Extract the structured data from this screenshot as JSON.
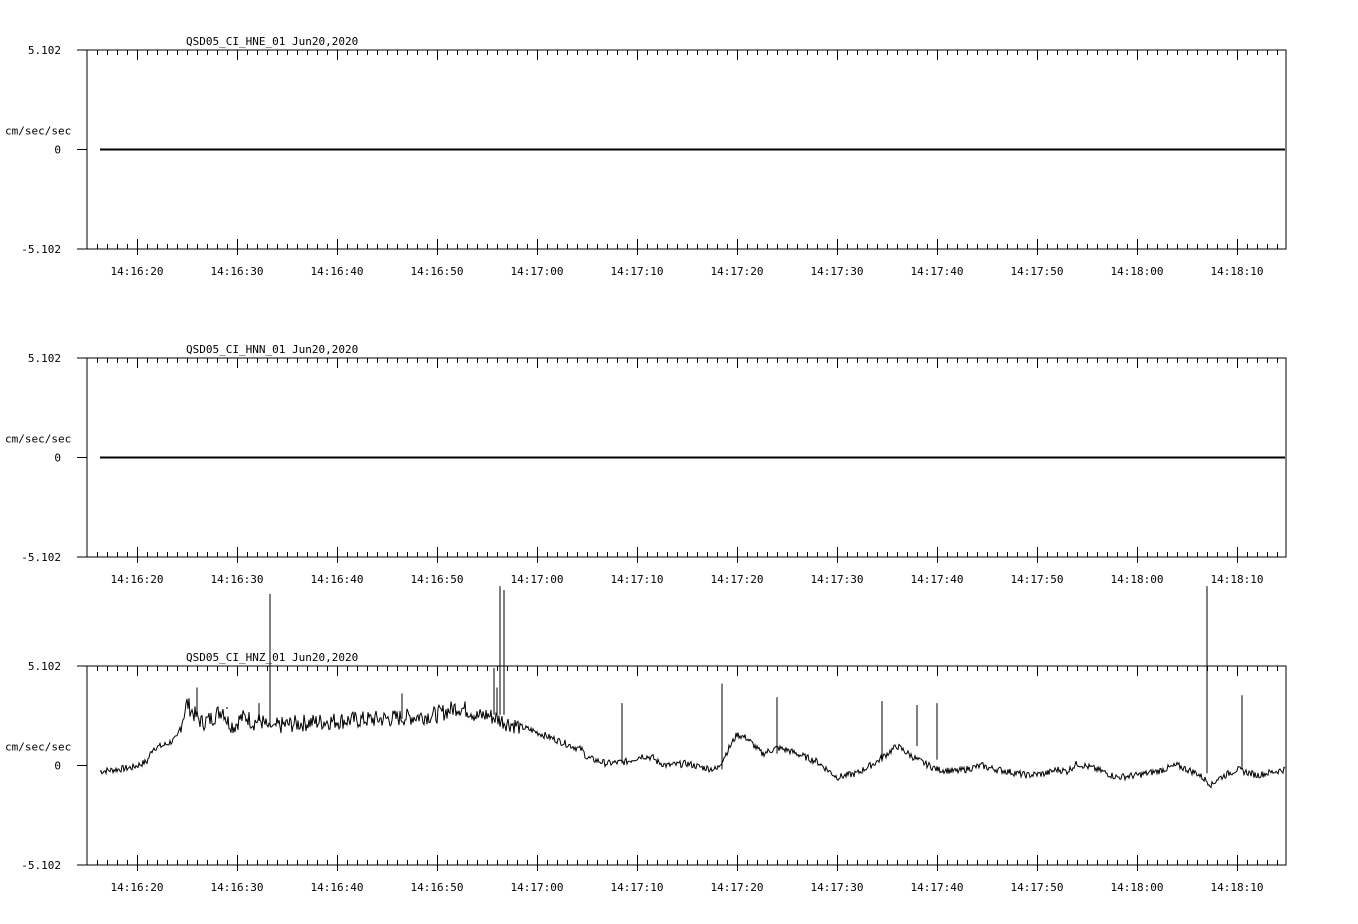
{
  "chart_data": [
    {
      "type": "line",
      "title": "QSD05_CI_HNE_01  Jun20,2020",
      "ylabel": "cm/sec/sec",
      "yticks": [
        "5.102",
        "0",
        "-5.102"
      ],
      "ylim": [
        -5.102,
        5.102
      ],
      "xticks": [
        "14:16:20",
        "14:16:30",
        "14:16:40",
        "14:16:50",
        "14:17:00",
        "14:17:10",
        "14:17:20",
        "14:17:30",
        "14:17:40",
        "14:17:50",
        "14:18:00",
        "14:18:10"
      ],
      "x_start_seconds_after_14_16_20": -3.7,
      "x_end_seconds_after_14_16_20": 114.8,
      "trace_style": "flat",
      "series": [
        {
          "x": [
            -3.7,
            114.8
          ],
          "y": [
            0,
            0
          ]
        }
      ]
    },
    {
      "type": "line",
      "title": "QSD05_CI_HNN_01  Jun20,2020",
      "ylabel": "cm/sec/sec",
      "yticks": [
        "5.102",
        "0",
        "-5.102"
      ],
      "ylim": [
        -5.102,
        5.102
      ],
      "xticks": [
        "14:16:20",
        "14:16:30",
        "14:16:40",
        "14:16:50",
        "14:17:00",
        "14:17:10",
        "14:17:20",
        "14:17:30",
        "14:17:40",
        "14:17:50",
        "14:18:00",
        "14:18:10"
      ],
      "x_start_seconds_after_14_16_20": -3.7,
      "x_end_seconds_after_14_16_20": 114.8,
      "trace_style": "flat",
      "series": [
        {
          "x": [
            -3.7,
            114.8
          ],
          "y": [
            0,
            0
          ]
        }
      ]
    },
    {
      "type": "line",
      "title": "QSD05_CI_HNZ_01  Jun20,2020",
      "ylabel": "cm/sec/sec",
      "yticks": [
        "5.102",
        "0",
        "-5.102"
      ],
      "ylim": [
        -5.102,
        5.102
      ],
      "xticks": [
        "14:16:20",
        "14:16:30",
        "14:16:40",
        "14:16:50",
        "14:17:00",
        "14:17:10",
        "14:17:20",
        "14:17:30",
        "14:17:40",
        "14:17:50",
        "14:18:00",
        "14:18:10"
      ],
      "x_start_seconds_after_14_16_20": -3.7,
      "x_end_seconds_after_14_16_20": 114.8,
      "trace_style": "noisy",
      "series": [
        {
          "x": [
            -3.7,
            -2.0,
            -0.5,
            1.0,
            1.6,
            2.5,
            3.0,
            4.0,
            5.0,
            5.6,
            6.5,
            7.4,
            8.6,
            9.0,
            9.7,
            10.3,
            11.0,
            11.6,
            12.0,
            12.4,
            13.0,
            13.2,
            13.8,
            15.0,
            17.0,
            20.0,
            25.0,
            30.0,
            32.0,
            33.4,
            34.0,
            35.0,
            37.0,
            39.5,
            41.0,
            43.0,
            44.5,
            45.0,
            47.0,
            49.0,
            50.5,
            51.6,
            52.0,
            53.0,
            55.0,
            56.5,
            58.0,
            60.0,
            61.0,
            62.5,
            64.0,
            65.0,
            68.0,
            70.0,
            72.0,
            74.0,
            76.0,
            78.0,
            80.0,
            82.0,
            84.5,
            85.0,
            87.0,
            89.0,
            91.0,
            92.0,
            93.0,
            94.0,
            96.0,
            98.0,
            100.0,
            102.0,
            104.0,
            106.0,
            107.5,
            108.0,
            110.0,
            112.0,
            114.8
          ],
          "y": [
            -0.3,
            -0.2,
            -0.1,
            0.2,
            0.9,
            1.0,
            1.1,
            1.4,
            3.2,
            2.7,
            2.2,
            2.4,
            2.9,
            2.3,
            2.0,
            2.4,
            2.5,
            2.2,
            2.3,
            2.3,
            2.0,
            2.0,
            2.0,
            2.1,
            2.2,
            2.3,
            2.4,
            2.6,
            3.0,
            2.8,
            2.5,
            2.6,
            2.2,
            1.8,
            1.5,
            1.1,
            0.8,
            0.4,
            0.1,
            0.2,
            0.5,
            0.4,
            0.2,
            0.0,
            0.1,
            -0.1,
            -0.2,
            1.6,
            1.4,
            0.6,
            0.9,
            0.8,
            0.2,
            -0.6,
            -0.4,
            0.2,
            1.0,
            0.3,
            -0.2,
            -0.3,
            0.0,
            -0.1,
            -0.3,
            -0.5,
            -0.4,
            -0.2,
            -0.3,
            0.1,
            -0.2,
            -0.6,
            -0.5,
            -0.3,
            0.0,
            -0.4,
            -1.0,
            -0.7,
            -0.2,
            -0.5,
            -0.2
          ]
        }
      ],
      "spikes": [
        {
          "x": 6.0,
          "y": 4.0
        },
        {
          "x": 9.0,
          "y": 3.0
        },
        {
          "x": 12.2,
          "y": 3.2
        },
        {
          "x": 13.3,
          "y": 8.8
        },
        {
          "x": 26.5,
          "y": 3.7
        },
        {
          "x": 36.0,
          "y": 4.0
        },
        {
          "x": 35.7,
          "y": 5.0
        },
        {
          "x": 36.3,
          "y": 9.2
        },
        {
          "x": 36.7,
          "y": 9.0
        },
        {
          "x": 48.5,
          "y": 3.2
        },
        {
          "x": 58.5,
          "y": 4.2
        },
        {
          "x": 64.0,
          "y": 3.5
        },
        {
          "x": 74.5,
          "y": 3.3
        },
        {
          "x": 78.0,
          "y": 3.1
        },
        {
          "x": 80.0,
          "y": 3.2
        },
        {
          "x": 107.0,
          "y": 9.2
        },
        {
          "x": 110.5,
          "y": 3.6
        }
      ]
    }
  ]
}
